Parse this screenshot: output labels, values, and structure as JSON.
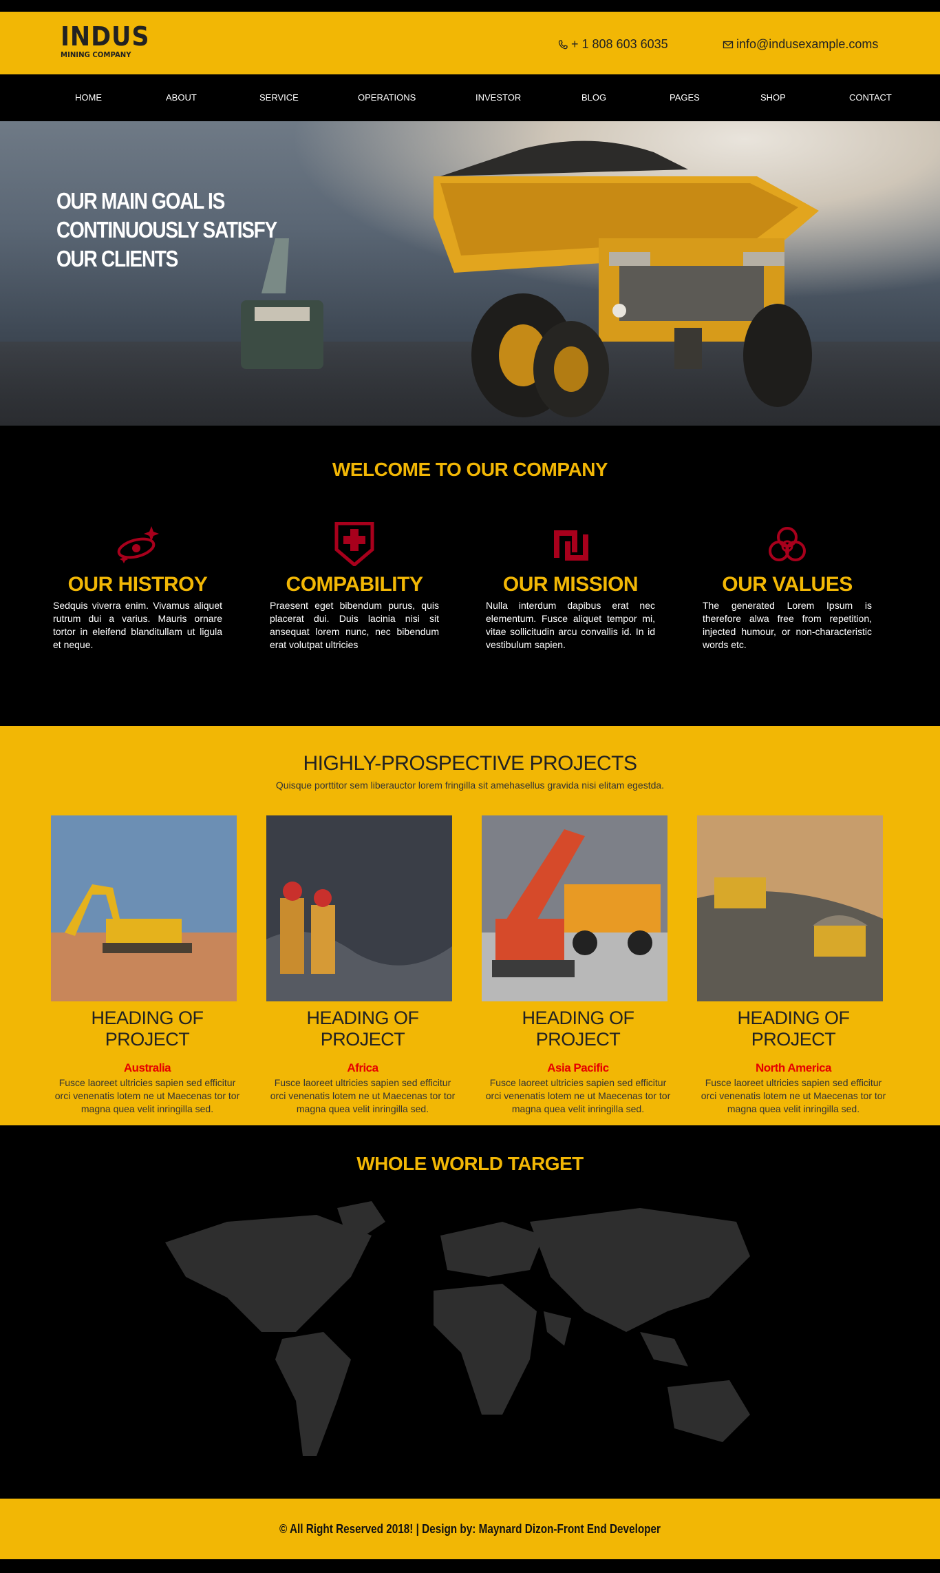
{
  "brand": {
    "name": "INDUS",
    "tagline": "MINING COMPANY"
  },
  "contact": {
    "phone": "+ 1 808 603 6035",
    "email": "info@indusexample.coms"
  },
  "nav": {
    "items": [
      "HOME",
      "ABOUT",
      "SERVICE",
      "OPERATIONS",
      "INVESTOR",
      "BLOG",
      "PAGES",
      "SHOP",
      "CONTACT"
    ]
  },
  "hero": {
    "heading": "OUR MAIN GOAL IS CONTINUOUSLY SATISFY OUR CLIENTS"
  },
  "welcome": {
    "title": "WELCOME TO OUR COMPANY",
    "features": [
      {
        "icon": "galaxy-icon",
        "title": "OUR HISTROY",
        "text": "Sedquis viverra enim. Vivamus aliquet rutrum dui a varius. Mauris ornare tortor in eleifend blanditullam ut ligula et neque."
      },
      {
        "icon": "shield-cross-icon",
        "title": "COMPABILITY",
        "text": "Praesent eget bibendum purus, quis placerat dui. Duis lacinia nisi sit ansequat lorem nunc, nec bibendum erat volutpat ultricies"
      },
      {
        "icon": "sheqel-icon",
        "title": "OUR MISSION",
        "text": "Nulla interdum dapibus erat nec elementum. Fusce aliquet tempor mi, vitae sollicitudin arcu convallis id. In id vestibulum sapien."
      },
      {
        "icon": "biohazard-icon",
        "title": "OUR VALUES",
        "text": "The generated Lorem Ipsum is therefore alwa free from repetition, injected humour, or non-characteristic words etc."
      }
    ]
  },
  "projects": {
    "title": "HIGHLY-PROSPECTIVE PROJECTS",
    "lead": "Quisque porttitor sem liberauctor lorem fringilla sit amehasellus gravida nisi elitam egestda.",
    "items": [
      {
        "heading": "HEADING OF PROJECT",
        "region": "Australia",
        "text": "Fusce laoreet ultricies sapien sed efficitur orci venenatis lotem ne ut Maecenas tor tor magna quea velit inringilla sed."
      },
      {
        "heading": "HEADING OF PROJECT",
        "region": "Africa",
        "text": "Fusce laoreet ultricies sapien sed efficitur orci venenatis lotem ne ut Maecenas tor tor magna quea velit inringilla sed."
      },
      {
        "heading": "HEADING OF PROJECT",
        "region": "Asia Pacific",
        "text": "Fusce laoreet ultricies sapien sed efficitur orci venenatis lotem ne ut Maecenas tor tor magna quea velit inringilla sed."
      },
      {
        "heading": "HEADING OF PROJECT",
        "region": "North America",
        "text": "Fusce laoreet ultricies sapien sed efficitur orci venenatis lotem ne ut Maecenas tor tor magna quea velit inringilla sed."
      }
    ]
  },
  "world": {
    "title": "WHOLE WORLD TARGET"
  },
  "footer": {
    "text": "© All Right Reserved 2018! | Design by: Maynard Dizon-Front End Developer"
  },
  "colors": {
    "accent": "#f2b705",
    "background": "#000000",
    "icon_red": "#a8001c",
    "region_red": "#e60000"
  }
}
